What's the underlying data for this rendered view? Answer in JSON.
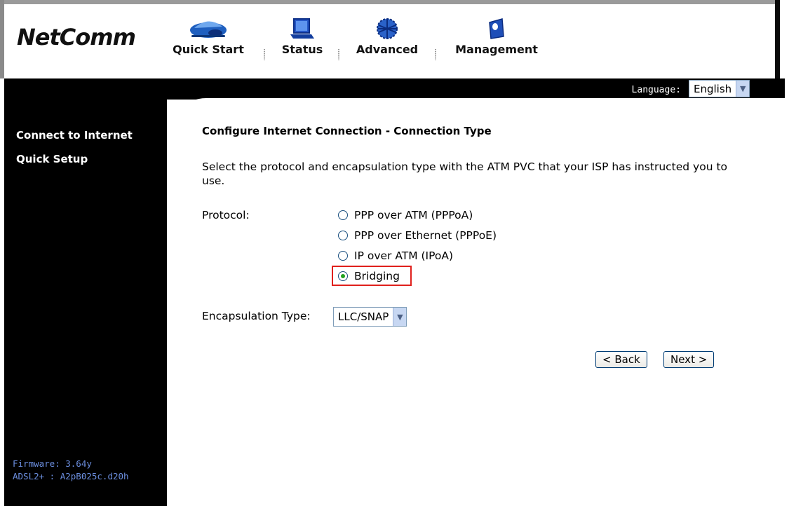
{
  "header": {
    "logo": "NetComm",
    "nav": [
      {
        "label": "Quick Start",
        "icon": "car-icon"
      },
      {
        "label": "Status",
        "icon": "laptop-icon"
      },
      {
        "label": "Advanced",
        "icon": "globe-icon"
      },
      {
        "label": "Management",
        "icon": "management-icon"
      }
    ]
  },
  "language": {
    "label": "Language:",
    "value": "English"
  },
  "sidebar": {
    "items": [
      {
        "label": "Connect to Internet"
      },
      {
        "label": "Quick Setup"
      }
    ],
    "firmware": "Firmware: 3.64y",
    "adsl": "ADSL2+ : A2pB025c.d20h"
  },
  "main": {
    "title": "Configure Internet Connection - Connection Type",
    "description": "Select the protocol and encapsulation type with the ATM PVC that your ISP has instructed you to use.",
    "protocol_label": "Protocol:",
    "protocols": [
      {
        "label": "PPP over ATM (PPPoA)",
        "checked": false
      },
      {
        "label": "PPP over Ethernet (PPPoE)",
        "checked": false
      },
      {
        "label": "IP over ATM (IPoA)",
        "checked": false
      },
      {
        "label": "Bridging",
        "checked": true
      }
    ],
    "encapsulation_label": "Encapsulation Type:",
    "encapsulation_value": "LLC/SNAP",
    "back_label": "< Back",
    "next_label": "Next >"
  },
  "colors": {
    "highlight": "#e0201c",
    "sidebar_bg": "#000000",
    "firmware_text": "#6c8fe0"
  }
}
